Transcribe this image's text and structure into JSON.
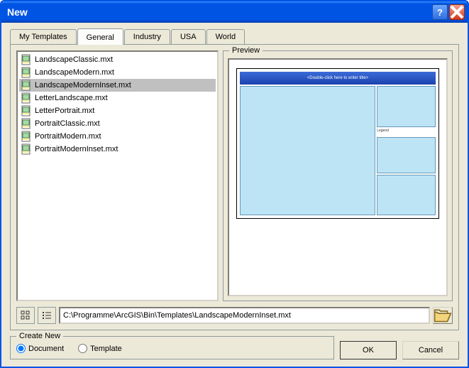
{
  "window": {
    "title": "New"
  },
  "tabs": {
    "my_templates": "My Templates",
    "general": "General",
    "industry": "Industry",
    "usa": "USA",
    "world": "World",
    "active": "general"
  },
  "files": [
    {
      "name": "LandscapeClassic.mxt",
      "selected": false
    },
    {
      "name": "LandscapeModern.mxt",
      "selected": false
    },
    {
      "name": "LandscapeModernInset.mxt",
      "selected": true
    },
    {
      "name": "LetterLandscape.mxt",
      "selected": false
    },
    {
      "name": "LetterPortrait.mxt",
      "selected": false
    },
    {
      "name": "PortraitClassic.mxt",
      "selected": false
    },
    {
      "name": "PortraitModern.mxt",
      "selected": false
    },
    {
      "name": "PortraitModernInset.mxt",
      "selected": false
    }
  ],
  "preview": {
    "label": "Preview",
    "header_text": "<Double-click here to enter title>",
    "legend_text": "Legend"
  },
  "path": {
    "value": "C:\\Programme\\ArcGIS\\Bin\\Templates\\LandscapeModernInset.mxt"
  },
  "create_new": {
    "label": "Create New",
    "document": "Document",
    "template": "Template",
    "selected": "document"
  },
  "buttons": {
    "ok": "OK",
    "cancel": "Cancel"
  }
}
